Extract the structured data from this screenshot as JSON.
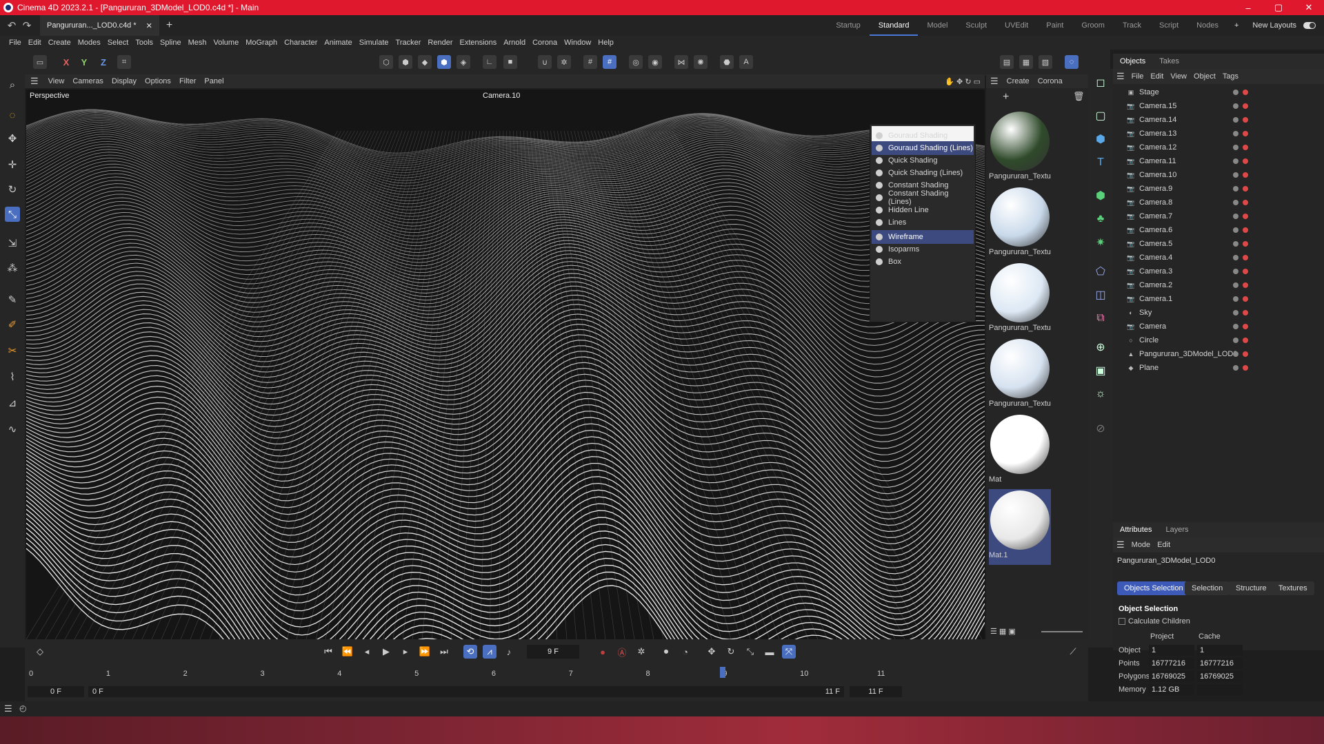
{
  "window": {
    "title": "Cinema 4D 2023.2.1 - [Pangururan_3DModel_LOD0.c4d *] - Main",
    "controls": [
      "–",
      "▢",
      "✕"
    ]
  },
  "tabs": {
    "document": "Pangururan..._LOD0.c4d *",
    "close": "✕",
    "add": "+"
  },
  "layouts": {
    "items": [
      "Startup",
      "Standard",
      "Model",
      "Sculpt",
      "UVEdit",
      "Paint",
      "Groom",
      "Track",
      "Script",
      "Nodes"
    ],
    "active": "Standard",
    "new_layouts": "New Layouts"
  },
  "menu": [
    "File",
    "Edit",
    "Create",
    "Modes",
    "Select",
    "Tools",
    "Spline",
    "Mesh",
    "Volume",
    "MoGraph",
    "Character",
    "Animate",
    "Simulate",
    "Tracker",
    "Render",
    "Extensions",
    "Arnold",
    "Corona",
    "Window",
    "Help"
  ],
  "toolbar": {
    "axes": [
      "X",
      "Y",
      "Z"
    ]
  },
  "viewport": {
    "menu": [
      "View",
      "Cameras",
      "Display",
      "Options",
      "Filter",
      "Panel"
    ],
    "label": "Perspective",
    "camera": "Camera.10"
  },
  "shading_menu": {
    "items": [
      "Gouraud Shading",
      "Gouraud Shading (Lines)",
      "Quick Shading",
      "Quick Shading (Lines)",
      "Constant Shading",
      "Constant Shading (Lines)",
      "Hidden Line",
      "Lines",
      "Wireframe",
      "Isoparms",
      "Box"
    ],
    "highlighted": [
      "Gouraud Shading (Lines)",
      "Wireframe"
    ]
  },
  "materials": {
    "menu": [
      "Create",
      "Corona"
    ],
    "items": [
      {
        "label": "Pangururan_Textu",
        "color": "#2f4a2a"
      },
      {
        "label": "Pangururan_Textu",
        "color": "#c9d9ea"
      },
      {
        "label": "Pangururan_Textu",
        "color": "#dce8f4"
      },
      {
        "label": "Pangururan_Textu",
        "color": "#d6e2f0"
      },
      {
        "label": "Mat",
        "color": "#ffffff"
      },
      {
        "label": "Mat.1",
        "color": "#e8e8e8"
      }
    ]
  },
  "objects_panel": {
    "tabs": [
      "Objects",
      "Takes"
    ],
    "menu": [
      "File",
      "Edit",
      "View",
      "Object",
      "Tags"
    ],
    "items": [
      "Stage",
      "Camera.15",
      "Camera.14",
      "Camera.13",
      "Camera.12",
      "Camera.11",
      "Camera.10",
      "Camera.9",
      "Camera.8",
      "Camera.7",
      "Camera.6",
      "Camera.5",
      "Camera.4",
      "Camera.3",
      "Camera.2",
      "Camera.1",
      "Sky",
      "Camera",
      "Circle",
      "Pangururan_3DModel_LOD0",
      "Plane"
    ]
  },
  "attributes": {
    "tabs": [
      "Attributes",
      "Layers"
    ],
    "menu": [
      "Mode",
      "Edit"
    ],
    "object_name": "Pangururan_3DModel_LOD0",
    "subtabs": [
      "Objects Selection",
      "Selection",
      "Structure",
      "Textures"
    ],
    "section": "Object Selection",
    "calculate_children": "Calculate Children",
    "columns": [
      "Project",
      "Cache"
    ],
    "rows": [
      {
        "label": "Object",
        "project": "1",
        "cache": "1"
      },
      {
        "label": "Points",
        "project": "16777216",
        "cache": "16777216"
      },
      {
        "label": "Polygons",
        "project": "16769025",
        "cache": "16769025"
      },
      {
        "label": "Memory",
        "project": "1.12 GB",
        "cache": ""
      }
    ]
  },
  "timeline": {
    "current_frame": "9 F",
    "ruler": [
      "0",
      "1",
      "2",
      "3",
      "4",
      "5",
      "6",
      "7",
      "8",
      "9",
      "10",
      "11"
    ],
    "start": "0 F",
    "start_preview": "0 F",
    "end_preview": "11 F",
    "end": "11 F",
    "playhead_frame": 9,
    "max_frame": 11
  }
}
